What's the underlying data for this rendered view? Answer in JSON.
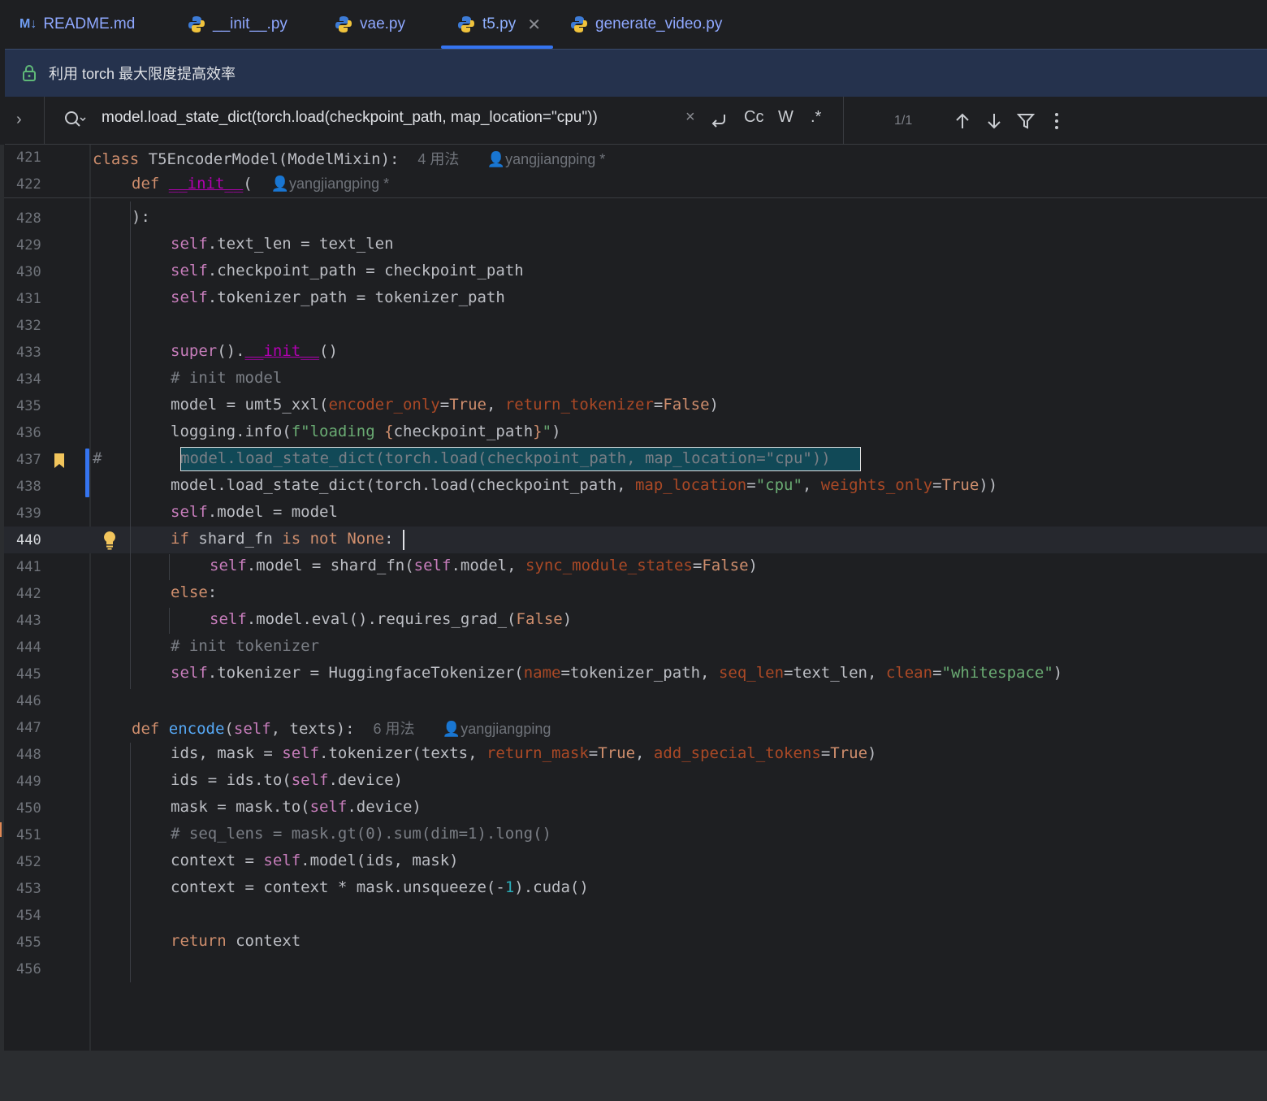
{
  "tabs": [
    {
      "icon": "markdown-icon",
      "label": "README.md"
    },
    {
      "icon": "python-icon",
      "label": "__init__.py"
    },
    {
      "icon": "python-icon",
      "label": "vae.py"
    },
    {
      "icon": "python-icon",
      "label": "t5.py",
      "active": true
    },
    {
      "icon": "python-icon",
      "label": "generate_video.py"
    }
  ],
  "tab_md_prefix": "M↓",
  "banner": {
    "text": "利用 torch 最大限度提高效率"
  },
  "find": {
    "query": "model.load_state_dict(torch.load(checkpoint_path, map_location=\"cpu\"))",
    "clear": "×",
    "case": "Cc",
    "word": "W",
    "regex": ".*",
    "count": "1/1"
  },
  "sticky": {
    "l421": "421",
    "l422": "422",
    "class_hint": "4 用法",
    "author1": "yangjiangping *",
    "author2": "yangjiangping *"
  },
  "lines": [
    "428",
    "429",
    "430",
    "431",
    "432",
    "433",
    "434",
    "435",
    "436",
    "437",
    "438",
    "439",
    "440",
    "441",
    "442",
    "443",
    "444",
    "445",
    "446",
    "447",
    "448",
    "449",
    "450",
    "451",
    "452",
    "453",
    "454",
    "455",
    "456"
  ],
  "encode_hint": "6 用法",
  "encode_author": "yangjiangping",
  "comment_marker": "#",
  "colors": {
    "accent": "#3574f0",
    "match_bg": "#114957"
  }
}
